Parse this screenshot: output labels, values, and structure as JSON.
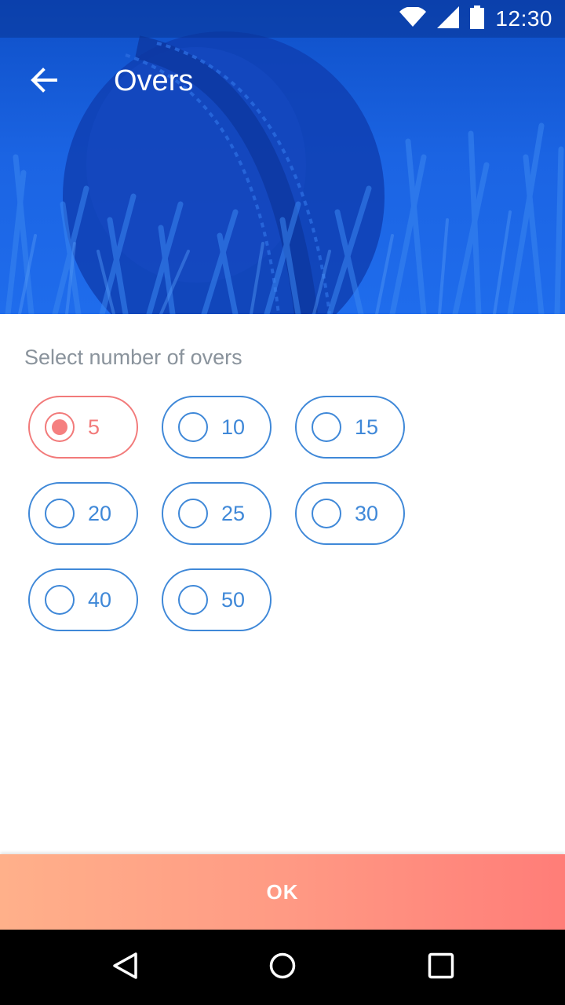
{
  "status_bar": {
    "time": "12:30",
    "icons": [
      "wifi-icon",
      "signal-icon",
      "battery-icon"
    ]
  },
  "toolbar": {
    "title": "Overs",
    "back_icon": "arrow-left-icon"
  },
  "content": {
    "label": "Select number of overs",
    "selected": "5",
    "options": [
      "5",
      "10",
      "15",
      "20",
      "25",
      "30",
      "40",
      "50"
    ]
  },
  "ok_button": {
    "label": "OK"
  },
  "nav_bar": {
    "icons": [
      "back-triangle-icon",
      "home-circle-icon",
      "recents-square-icon"
    ]
  },
  "colors": {
    "accent_blue": "#3f88d8",
    "selected_red": "#f27a7a",
    "header_blue": "#1b64e3"
  }
}
